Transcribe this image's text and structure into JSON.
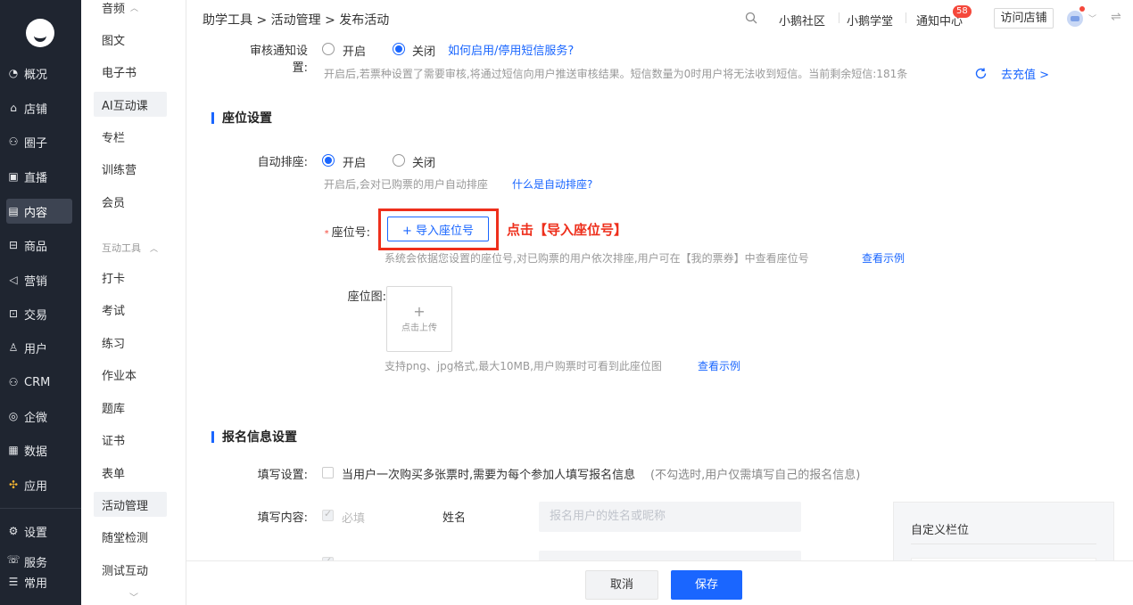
{
  "nav": {
    "items": [
      {
        "label": "概况",
        "icon": "overview-icon",
        "glyph": "◔"
      },
      {
        "label": "店铺",
        "icon": "shop-icon",
        "glyph": "⌂"
      },
      {
        "label": "圈子",
        "icon": "circle-icon",
        "glyph": "⚇"
      },
      {
        "label": "直播",
        "icon": "live-icon",
        "glyph": "▣"
      },
      {
        "label": "内容",
        "icon": "content-icon",
        "glyph": "▤"
      },
      {
        "label": "商品",
        "icon": "goods-icon",
        "glyph": "⊟"
      },
      {
        "label": "营销",
        "icon": "marketing-icon",
        "glyph": "◁"
      },
      {
        "label": "交易",
        "icon": "trade-icon",
        "glyph": "⊡"
      },
      {
        "label": "用户",
        "icon": "user-icon",
        "glyph": "♙"
      },
      {
        "label": "CRM",
        "icon": "crm-icon",
        "glyph": "⚇"
      },
      {
        "label": "企微",
        "icon": "wecom-icon",
        "glyph": "◎"
      },
      {
        "label": "数据",
        "icon": "data-icon",
        "glyph": "▦"
      },
      {
        "label": "应用",
        "icon": "apps-icon",
        "glyph": "✣"
      },
      {
        "label": "设置",
        "icon": "settings-icon",
        "glyph": "⚙"
      },
      {
        "label": "服务",
        "icon": "service-icon",
        "glyph": "☏"
      },
      {
        "label": "常用",
        "icon": "common-icon",
        "glyph": "☰"
      }
    ],
    "active": "内容"
  },
  "sub": {
    "top_partial": "音频",
    "items_a": [
      "图文",
      "电子书",
      "AI互动课",
      "专栏",
      "训练营",
      "会员"
    ],
    "group_label": "互动工具",
    "items_b": [
      "打卡",
      "考试",
      "练习",
      "作业本",
      "题库",
      "证书",
      "表单",
      "活动管理",
      "随堂检测",
      "测试互动"
    ],
    "active": "活动管理"
  },
  "topbar": {
    "breadcrumb": "助学工具 > 活动管理 > 发布活动",
    "links": [
      "小鹅社区",
      "小鹅学堂",
      "通知中心"
    ],
    "badge": "58",
    "visit_store": "访问店铺"
  },
  "review": {
    "label": "审核通知设置:",
    "on": "开启",
    "off": "关闭",
    "selected": "关闭",
    "help_link": "如何启用/停用短信服务?",
    "hint": "开启后,若票种设置了需要审核,将通过短信向用户推送审核结果。短信数量为0时用户将无法收到短信。当前剩余短信:181条",
    "recharge": "去充值 >"
  },
  "seat": {
    "title": "座位设置",
    "auto_label": "自动排座:",
    "on": "开启",
    "off": "关闭",
    "selected": "开启",
    "auto_hint": "开启后,会对已购票的用户自动排座",
    "auto_link": "什么是自动排座?",
    "seat_no_label": "座位号:",
    "import_btn": "+ 导入座位号",
    "annotation": "点击【导入座位号】",
    "seat_no_hint": "系统会依据您设置的座位号,对已购票的用户依次排座,用户可在【我的票券】中查看座位号",
    "seat_no_link": "查看示例",
    "map_label": "座位图:",
    "upload_plus": "+",
    "upload_text": "点击上传",
    "map_hint": "支持png、jpg格式,最大10MB,用户购票时可看到此座位图",
    "map_link": "查看示例"
  },
  "signup": {
    "title": "报名信息设置",
    "fill_label": "填写设置:",
    "fill_text": "当用户一次购买多张票时,需要为每个参加人填写报名信息",
    "fill_note": "(不勾选时,用户仅需填写自己的报名信息)",
    "content_label": "填写内容:",
    "required": "必填",
    "name_field": "姓名",
    "name_placeholder": "报名用户的姓名或昵称",
    "custom_panel": "自定义栏位"
  },
  "footer": {
    "cancel": "取消",
    "save": "保存"
  },
  "colors": {
    "primary": "#1a66ff",
    "annotation_red": "#ee2f1c",
    "nav_bg": "#1f2530"
  }
}
